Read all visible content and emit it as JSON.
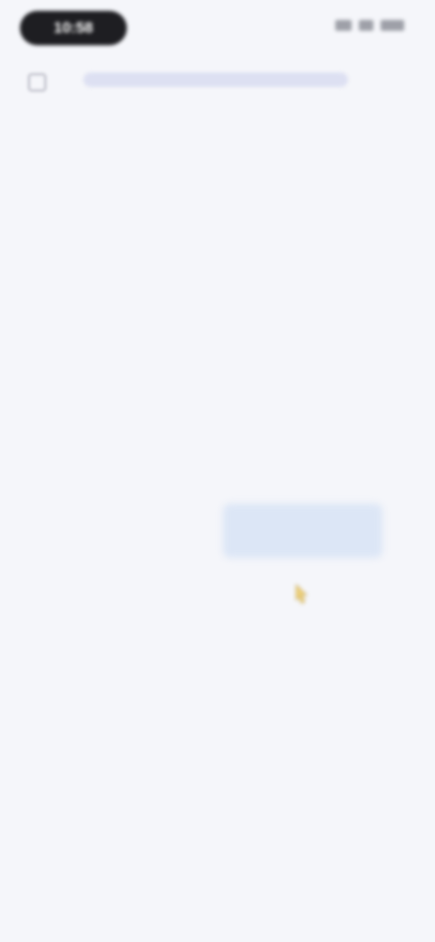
{
  "status_bar": {
    "time": "10:58"
  },
  "url_bar": {
    "url": ""
  },
  "dialog": {
    "title": "",
    "body": "",
    "cancel_label": "",
    "confirm_label": ""
  },
  "colors": {
    "background": "#f5f6fa",
    "title_text": "#2a2a2e",
    "body_text": "#6d6e76",
    "link_blue": "#8fa4cf",
    "confirm_bg": "#dce6f6",
    "confirm_text": "#6f8fd2"
  },
  "icons": {
    "url_left": "tabs-icon",
    "cursor": "pointer-cursor-icon"
  }
}
